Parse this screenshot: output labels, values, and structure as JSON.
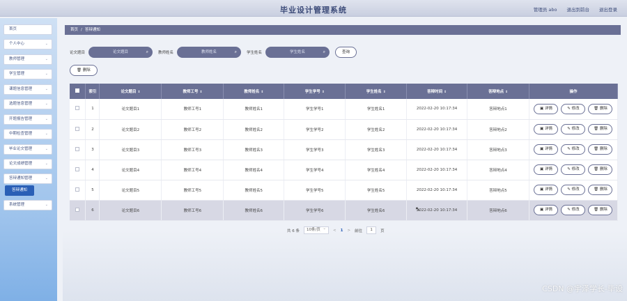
{
  "header": {
    "title": "毕业设计管理系统",
    "admin_label": "管理员 abo",
    "back_label": "退出到前台",
    "logout_label": "退出登录"
  },
  "sidebar": {
    "items": [
      {
        "label": "首页",
        "has_chevron": false
      },
      {
        "label": "个人中心",
        "has_chevron": true
      },
      {
        "label": "教师管理",
        "has_chevron": true
      },
      {
        "label": "学生管理",
        "has_chevron": true
      },
      {
        "label": "课题信息管理",
        "has_chevron": true
      },
      {
        "label": "选题信息管理",
        "has_chevron": true
      },
      {
        "label": "开题报告管理",
        "has_chevron": true
      },
      {
        "label": "中期检查管理",
        "has_chevron": true
      },
      {
        "label": "毕业论文管理",
        "has_chevron": true
      },
      {
        "label": "论文成绩管理",
        "has_chevron": true
      },
      {
        "label": "答辩通知管理",
        "has_chevron": true
      },
      {
        "label": "系统管理",
        "has_chevron": true
      }
    ],
    "active_sub": "答辩通知"
  },
  "breadcrumb": {
    "home": "首页",
    "sep": "/",
    "current": "答辩通知"
  },
  "search": {
    "fields": [
      {
        "label": "论文题目",
        "placeholder": "论文题目"
      },
      {
        "label": "教师姓名",
        "placeholder": "教师姓名"
      },
      {
        "label": "学生姓名",
        "placeholder": "学生姓名"
      }
    ],
    "query_label": "查询"
  },
  "toolbar": {
    "delete_label": "删除"
  },
  "table": {
    "headers": [
      "索引",
      "论文题目",
      "教师工号",
      "教师姓名",
      "学生学号",
      "学生姓名",
      "答辩时间",
      "答辩地点",
      "操作"
    ],
    "rows": [
      {
        "idx": "1",
        "topic": "论文题目1",
        "tno": "教师工号1",
        "tname": "教师姓名1",
        "sno": "学生学号1",
        "sname": "学生姓名1",
        "time": "2022-02-20 10:17:34",
        "place": "答辩地点1"
      },
      {
        "idx": "2",
        "topic": "论文题目2",
        "tno": "教师工号2",
        "tname": "教师姓名2",
        "sno": "学生学号2",
        "sname": "学生姓名2",
        "time": "2022-02-20 10:17:34",
        "place": "答辩地点2"
      },
      {
        "idx": "3",
        "topic": "论文题目3",
        "tno": "教师工号3",
        "tname": "教师姓名3",
        "sno": "学生学号3",
        "sname": "学生姓名3",
        "time": "2022-02-20 10:17:34",
        "place": "答辩地点3"
      },
      {
        "idx": "4",
        "topic": "论文题目4",
        "tno": "教师工号4",
        "tname": "教师姓名4",
        "sno": "学生学号4",
        "sname": "学生姓名4",
        "time": "2022-02-20 10:17:34",
        "place": "答辩地点4"
      },
      {
        "idx": "5",
        "topic": "论文题目5",
        "tno": "教师工号5",
        "tname": "教师姓名5",
        "sno": "学生学号5",
        "sname": "学生姓名5",
        "time": "2022-02-20 10:17:34",
        "place": "答辩地点5"
      },
      {
        "idx": "6",
        "topic": "论文题目6",
        "tno": "教师工号6",
        "tname": "教师姓名6",
        "sno": "学生学号6",
        "sname": "学生姓名6",
        "time": "2022-02-20 10:17:34",
        "place": "答辩地点6"
      }
    ],
    "ops": {
      "detail": "详情",
      "edit": "修改",
      "delete": "删除"
    },
    "highlight_row": 6
  },
  "pager": {
    "total_label": "共 6 条",
    "page_size": "10条/页",
    "prev": "<",
    "current_page": "1",
    "next": ">",
    "goto_label": "前往",
    "goto_value": "1",
    "page_unit": "页"
  },
  "watermark": "CSDN @宇泽学长-毕设",
  "colors": {
    "accent": "#6a7095",
    "active": "#2a5fb6"
  }
}
